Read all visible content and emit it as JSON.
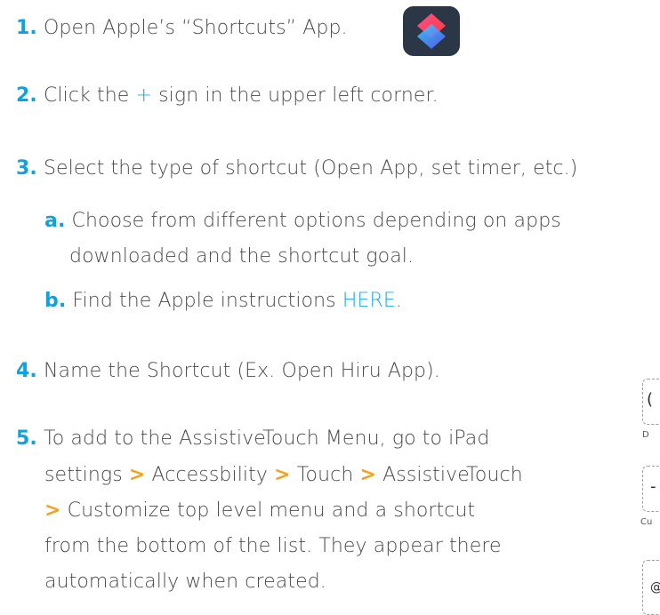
{
  "steps": {
    "s1": {
      "num": "1.",
      "text": "Open Apple’s “Shortcuts” App."
    },
    "s2": {
      "num": "2.",
      "pre": "Click the ",
      "plus": "+",
      "post": " sign in the upper left corner."
    },
    "s3": {
      "num": "3.",
      "text": "Select the type of shortcut (Open App, set timer, etc.)"
    },
    "s3a": {
      "letter": "a.",
      "line1": "Choose from different options depending on apps",
      "line2": "downloaded and the shortcut goal."
    },
    "s3b": {
      "letter": "b.",
      "pre": "Find the Apple instructions ",
      "link": "HERE",
      "post": "."
    },
    "s4": {
      "num": "4.",
      "text": "Name the Shortcut (Ex. Open Hiru App)."
    },
    "s5": {
      "num": "5.",
      "line1": "To add to the AssistiveTouch Menu, go to iPad",
      "line2_a": "settings ",
      "gt": ">",
      "line2_b": " Accessbility ",
      "line2_c": " Touch ",
      "line2_d": " AssistiveTouch",
      "line3_b": " Customize top level menu and a shortcut",
      "line4": "from the bottom of the list. They appear there",
      "line5": "automatically when created."
    }
  },
  "side": {
    "glyph1": "(",
    "label1": "D",
    "glyph2": "-",
    "label2": "Cu",
    "glyph3": "@"
  },
  "colors": {
    "accent": "#0ea3df",
    "separator": "#f3a21c",
    "text": "#4a4a4a"
  },
  "icons": {
    "app": "shortcuts-app-icon"
  }
}
